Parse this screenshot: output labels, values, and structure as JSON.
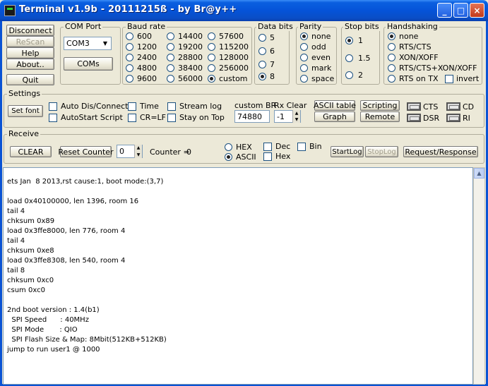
{
  "window": {
    "title": "Terminal v1.9b - 20111215ß - by Br@y++",
    "minimize": "_",
    "maximize": "□",
    "close": "×"
  },
  "buttons": {
    "disconnect": "Disconnect",
    "rescan": "ReScan",
    "help": "Help",
    "about": "About..",
    "quit": "Quit",
    "coms": "COMs",
    "set_font": "Set font",
    "clear": "CLEAR",
    "reset_counter": "Reset Counter",
    "ascii_table": "ASCII table",
    "graph": "Graph",
    "scripting": "Scripting",
    "remote": "Remote",
    "startlog": "StartLog",
    "stoplog": "StopLog",
    "request_response": "Request/Response"
  },
  "com_port": {
    "title": "COM Port",
    "value": "COM3"
  },
  "baud_rate": {
    "title": "Baud rate",
    "options": [
      "600",
      "1200",
      "2400",
      "4800",
      "9600",
      "14400",
      "19200",
      "28800",
      "38400",
      "56000",
      "57600",
      "115200",
      "128000",
      "256000",
      "custom"
    ],
    "selected": "custom"
  },
  "data_bits": {
    "title": "Data bits",
    "options": [
      "5",
      "6",
      "7",
      "8"
    ],
    "selected": "8"
  },
  "parity": {
    "title": "Parity",
    "options": [
      "none",
      "odd",
      "even",
      "mark",
      "space"
    ],
    "selected": "none"
  },
  "stop_bits": {
    "title": "Stop bits",
    "options": [
      "1",
      "1.5",
      "2"
    ],
    "selected": "1"
  },
  "handshaking": {
    "title": "Handshaking",
    "options": [
      "none",
      "RTS/CTS",
      "XON/XOFF",
      "RTS/CTS+XON/XOFF",
      "RTS on TX"
    ],
    "selected": "none",
    "invert": "invert"
  },
  "settings": {
    "title": "Settings",
    "auto_dis": "Auto Dis/Connect",
    "auto_start": "AutoStart Script",
    "time": "Time",
    "crlf": "CR=LF",
    "stream_log": "Stream log",
    "stay_on_top": "Stay on Top",
    "custom_br_label": "custom BR",
    "custom_br_value": "74880",
    "rx_clear_label": "Rx Clear",
    "rx_clear_value": "-1"
  },
  "signals": {
    "cts": "CTS",
    "cd": "CD",
    "dsr": "DSR",
    "ri": "RI"
  },
  "receive": {
    "title": "Receive",
    "counter_value": "0",
    "counter_label": "Counter =",
    "counter_count": "0",
    "hex": "HEX",
    "ascii": "ASCII",
    "dec": "Dec",
    "hex2": "Hex",
    "bin": "Bin",
    "mode_selected": "ASCII"
  },
  "terminal": {
    "lines": [
      "ets Jan  8 2013,rst cause:1, boot mode:(3,7)",
      "",
      "load 0x40100000, len 1396, room 16",
      "tail 4",
      "chksum 0x89",
      "load 0x3ffe8000, len 776, room 4",
      "tail 4",
      "chksum 0xe8",
      "load 0x3ffe8308, len 540, room 4",
      "tail 8",
      "chksum 0xc0",
      "csum 0xc0",
      "",
      "2nd boot version : 1.4(b1)",
      "  SPI Speed      : 40MHz",
      "  SPI Mode       : QIO",
      "  SPI Flash Size & Map: 8Mbit(512KB+512KB)",
      "jump to run user1 @ 1000"
    ]
  }
}
